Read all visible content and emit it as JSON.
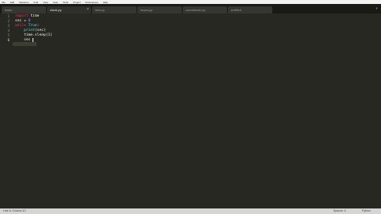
{
  "menubar": {
    "items": [
      "File",
      "Edit",
      "Selection",
      "Find",
      "View",
      "Goto",
      "Tools",
      "Project",
      "Preferences",
      "Help"
    ]
  },
  "tabs": [
    {
      "label": "basic",
      "active": false
    },
    {
      "label": "clock.py",
      "active": true
    },
    {
      "label": "test.py",
      "active": false
    },
    {
      "label": "loops.py",
      "active": false
    },
    {
      "label": "countdown.py",
      "active": false
    },
    {
      "label": "untitled",
      "active": false
    }
  ],
  "editor": {
    "line_numbers": [
      "1",
      "2",
      "3",
      "4",
      "5",
      "6"
    ],
    "current_line": 6,
    "lines": [
      {
        "kw": "import",
        "rest": " time"
      },
      {
        "text": "sec = ",
        "num": "0"
      },
      {
        "kw": "while",
        "sp": " ",
        "bi": "True",
        "rest": ":"
      },
      {
        "indent": "    ",
        "bi": "print",
        "rest": "(sec)"
      },
      {
        "indent": "    ",
        "text": "time.sleep(1)"
      },
      {
        "indent": "    ",
        "text": "sec "
      }
    ]
  },
  "status": {
    "left": "Line 6, Column 10",
    "tab_size": "Spaces: 4",
    "syntax": "Python"
  },
  "colors": {
    "background": "#272822",
    "keyword": "#f92672",
    "builtin": "#66d9ef",
    "number": "#ae81ff"
  }
}
